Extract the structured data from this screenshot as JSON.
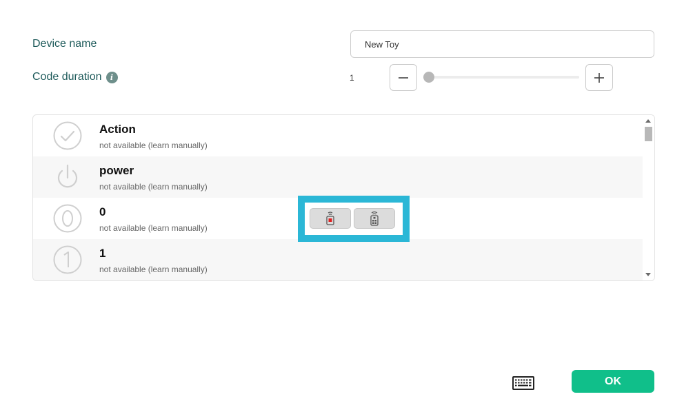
{
  "form": {
    "device_name_label": "Device name",
    "device_name_value": "New Toy",
    "code_duration_label": "Code duration",
    "code_duration_value": "1",
    "info_icon_glyph": "i"
  },
  "list": {
    "items": [
      {
        "title": "Action",
        "subtitle": "not available (learn manually)",
        "icon": "check-circle-icon"
      },
      {
        "title": "power",
        "subtitle": "not available (learn manually)",
        "icon": "power-icon"
      },
      {
        "title": "0",
        "subtitle": "not available (learn manually)",
        "icon": "digit-0-icon"
      },
      {
        "title": "1",
        "subtitle": "not available (learn manually)",
        "icon": "digit-1-icon"
      }
    ]
  },
  "popup": {
    "accent_color": "#2bb7d6",
    "buttons": [
      "record-signal-icon",
      "remote-control-icon"
    ]
  },
  "footer": {
    "ok_label": "OK",
    "ok_color": "#10bf8a"
  }
}
